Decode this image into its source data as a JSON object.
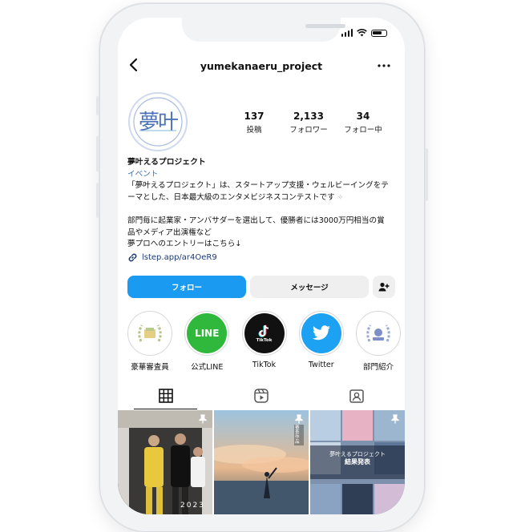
{
  "status_bar": {
    "icons": [
      "signal-icon",
      "wifi-icon",
      "battery-icon"
    ]
  },
  "header": {
    "username": "yumekanaeru_project",
    "back_icon": "chevron-left-icon",
    "more_icon": "more-dots-icon"
  },
  "avatar": {
    "logo_text": "夢叶"
  },
  "stats": [
    {
      "value": "137",
      "label": "投稿"
    },
    {
      "value": "2,133",
      "label": "フォロワー"
    },
    {
      "value": "34",
      "label": "フォロー中"
    }
  ],
  "bio": {
    "name": "夢叶えるプロジェクト",
    "category": "イベント",
    "line1": "「夢叶えるプロジェクト」は、スタートアップ支援・ウェルビーイングをテ",
    "line2": "ーマとした、日本最大級のエンタメビジネスコンテストです",
    "line3": "部門毎に起業家・アンバサダーを選出して、優勝者には3000万円相当の賞",
    "line4": "品やメディア出演権など",
    "line5": "夢プロへのエントリーはこちら↓"
  },
  "link": {
    "text": "lstep.app/ar4OeR9",
    "icon": "link-icon"
  },
  "buttons": {
    "follow": "フォロー",
    "message": "メッセージ",
    "add_icon": "add-person-icon"
  },
  "highlights": [
    {
      "label": "豪華審査員",
      "icon": "laurel-badge-icon"
    },
    {
      "label": "公式LINE",
      "icon": "line-logo-icon",
      "logo_text": "LINE"
    },
    {
      "label": "TikTok",
      "icon": "tiktok-logo-icon",
      "logo_text": "TikTok"
    },
    {
      "label": "Twitter",
      "icon": "twitter-bird-icon"
    },
    {
      "label": "部門紹介",
      "icon": "laurel-badge-icon"
    }
  ],
  "tabs": [
    "grid-icon",
    "reels-icon",
    "tagged-icon"
  ],
  "posts": [
    {
      "overlay_text": "2023",
      "icon": "pin-icon"
    },
    {
      "badge": "審査作品",
      "icon": "pin-icon"
    },
    {
      "caption1": "夢叶えるプロジェクト",
      "caption2": "結果発表",
      "icon": "pin-icon"
    }
  ],
  "colors": {
    "follow_button": "#1a9af0",
    "line_green": "#2fb83c",
    "twitter_blue": "#1da1f2",
    "link_blue": "#1b3a78"
  }
}
